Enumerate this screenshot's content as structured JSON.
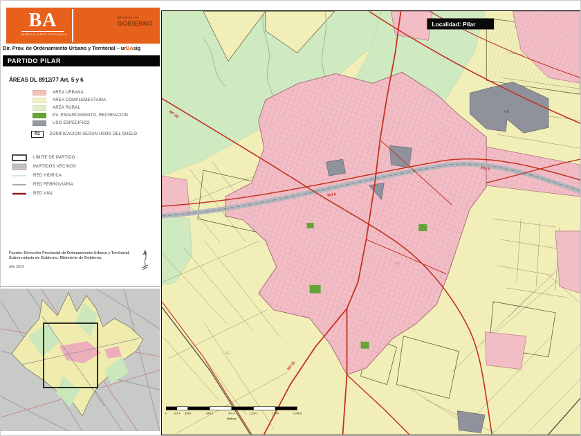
{
  "header": {
    "logo": "BA",
    "logo_caption": "BUENOS AIRES PROVINCIA",
    "ministry_small": "Ministerio de",
    "ministry_big": "GOBIERNO",
    "direction_prefix": "Dir. Prov. de Ordenamiento Urbano y Territorial – ur",
    "direction_brand": "BA",
    "direction_suffix": "sig",
    "partido_title": "PARTIDO PILAR"
  },
  "legend": {
    "areas_title": "ÁREAS DL 8912/77 Art. 5 y 6",
    "area_items": [
      {
        "label": "AREA URBANA",
        "color": "#F3C0BA"
      },
      {
        "label": "AREA COMPLEMENTARIA",
        "color": "#F4F1C7"
      },
      {
        "label": "AREA RURAL",
        "color": "#E2EFC6"
      },
      {
        "label": "EV. ESPARCIMIENTO, RECREACION",
        "color": "#64A437"
      },
      {
        "label": "USO ESPECIFICO",
        "color": "#989BA3"
      }
    ],
    "zoning_code": "R1",
    "zoning_label": "ZONIFICACION SEGUN USOS DEL SUELO",
    "line_items": [
      {
        "label": "LIMITE DE PARTIDO"
      },
      {
        "label": "PARTIDOS VECINOS"
      },
      {
        "label": "RED HIDRICA",
        "color": "#9CC8D8"
      },
      {
        "label": "RED FERROVIARIA",
        "color": "#8A8E96"
      },
      {
        "label": "RED VIAL",
        "color": "#8E1A12"
      }
    ]
  },
  "source": {
    "line1": "Fuente: Dirección Provincial de Ordenamiento Urbano y Territorial.",
    "line2": "Subsecretaría de Gobierno. Ministerio de Gobierno.",
    "date": "Año 2014"
  },
  "map": {
    "locality_label": "Localidad: Pilar",
    "road_labels": {
      "rn8_a": "RN 8",
      "rn8_b": "RN 8",
      "rp25": "RP 25",
      "rp28": "RP 28"
    },
    "zone_labels": {
      "ue": "UE",
      "cc_a": "CC",
      "cc_b": "CC"
    },
    "scalebar": {
      "ticks": [
        "0",
        "162.4",
        "324.8",
        "649.5",
        "974.4",
        "1,299.2",
        "1,624",
        "1,948.8"
      ],
      "unit": "Metros"
    }
  },
  "colors": {
    "accent_orange": "#E8611C",
    "urban_pink": "#F3BDC6",
    "complementary_yellow": "#F1EEB8",
    "rural_green": "#CFE9C0",
    "ev_green": "#64A437",
    "special_gray": "#90929B",
    "road_red": "#C2321E",
    "rail_gray": "#B3B7BE",
    "inset_bg": "#C8CAC8"
  }
}
